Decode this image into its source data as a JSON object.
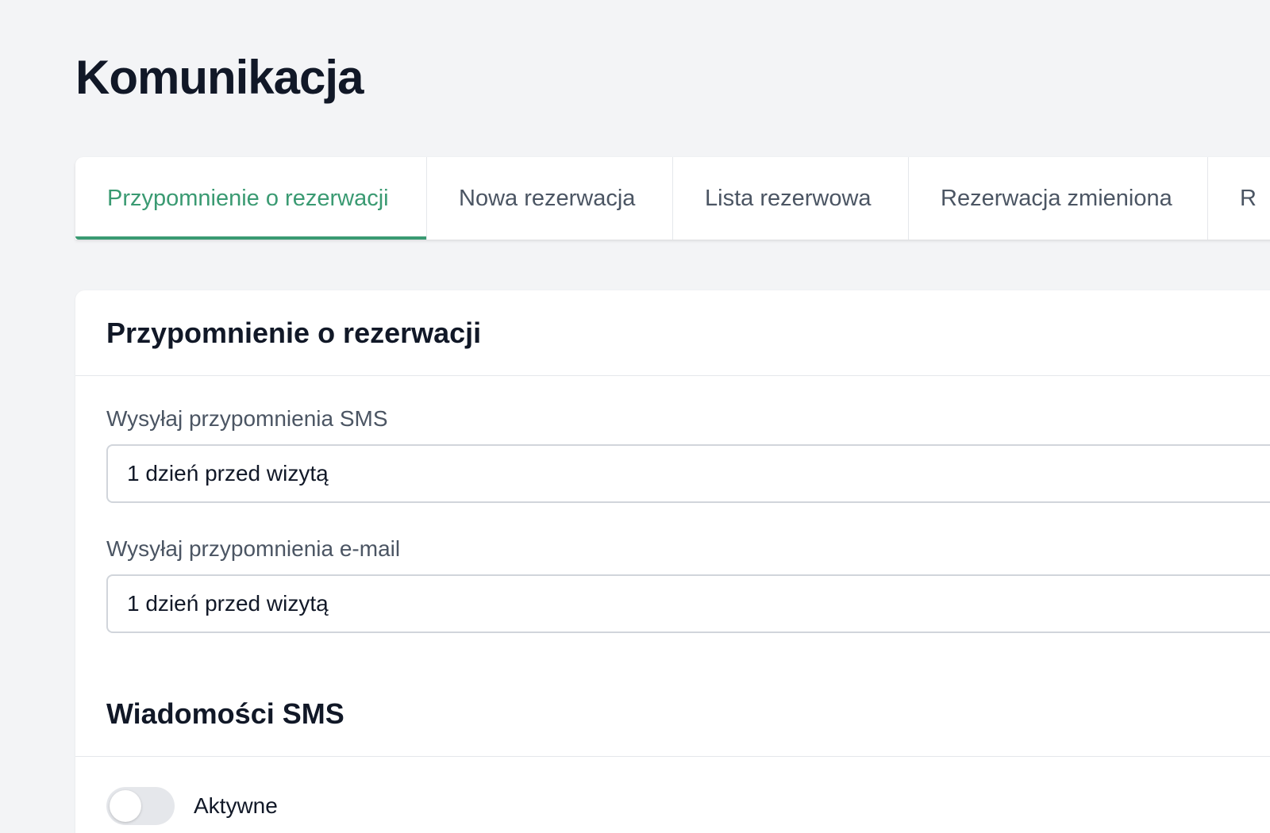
{
  "page": {
    "title": "Komunikacja"
  },
  "tabs": [
    {
      "label": "Przypomnienie o rezerwacji",
      "active": true
    },
    {
      "label": "Nowa rezerwacja",
      "active": false
    },
    {
      "label": "Lista rezerwowa",
      "active": false
    },
    {
      "label": "Rezerwacja zmieniona",
      "active": false
    },
    {
      "label": "R",
      "active": false
    }
  ],
  "reminder_section": {
    "title": "Przypomnienie o rezerwacji",
    "sms_reminder": {
      "label": "Wysyłaj przypomnienia SMS",
      "value": "1 dzień przed wizytą"
    },
    "email_reminder": {
      "label": "Wysyłaj przypomnienia e-mail",
      "value": "1 dzień przed wizytą"
    }
  },
  "sms_section": {
    "title": "Wiadomości SMS",
    "active_toggle": {
      "label": "Aktywne",
      "on": false
    }
  },
  "colors": {
    "accent": "#3a9a72",
    "background": "#f3f4f6",
    "text": "#111827",
    "muted_text": "#4b5563"
  }
}
